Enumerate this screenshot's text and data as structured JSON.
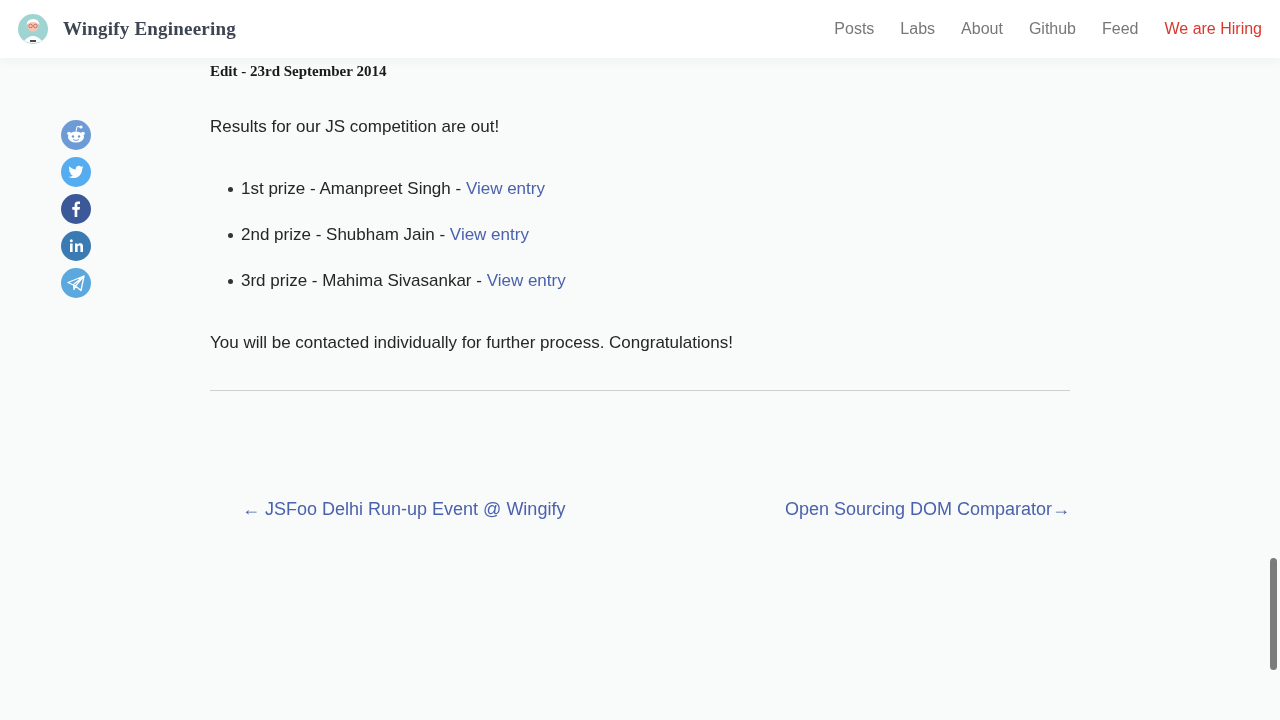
{
  "header": {
    "site_title": "Wingify Engineering",
    "nav": [
      {
        "label": "Posts",
        "kind": "plain"
      },
      {
        "label": "Labs",
        "kind": "plain"
      },
      {
        "label": "About",
        "kind": "plain"
      },
      {
        "label": "Github",
        "kind": "plain"
      },
      {
        "label": "Feed",
        "kind": "plain"
      },
      {
        "label": "We are Hiring",
        "kind": "highlight"
      }
    ]
  },
  "article": {
    "edit_heading": "Edit - 23rd September 2014",
    "intro": "Results for our JS competition are out!",
    "prizes": [
      {
        "text": "1st prize - Amanpreet Singh -",
        "link": "View entry"
      },
      {
        "text": "2nd prize - Shubham Jain -",
        "link": "View entry"
      },
      {
        "text": "3rd prize - Mahima Sivasankar -",
        "link": "View entry"
      }
    ],
    "closing": "You will be contacted individually for further process. Congratulations!"
  },
  "post_nav": {
    "previous": "← JSFoo Delhi Run-up Event @ Wingify",
    "next": "Open Sourcing DOM Comparator→"
  }
}
